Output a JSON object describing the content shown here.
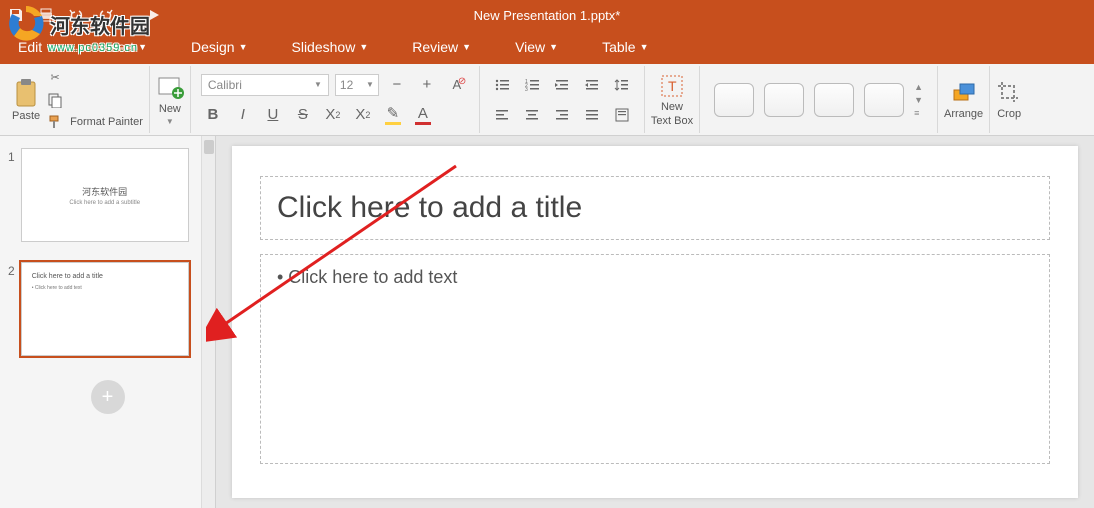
{
  "watermark": {
    "brand": "河东软件园",
    "url": "www.pc0359.cn"
  },
  "titlebar": {
    "doc_title": "New Presentation 1.pptx*"
  },
  "menus": {
    "edit": "Edit",
    "insert": "Insert",
    "design": "Design",
    "slideshow": "Slideshow",
    "review": "Review",
    "view": "View",
    "table": "Table"
  },
  "ribbon": {
    "paste": "Paste",
    "format_painter": "Format Painter",
    "new_slide": "New",
    "font_name": "Calibri",
    "font_size": "12",
    "new_text_box": "New",
    "new_text_box2": "Text Box",
    "arrange": "Arrange",
    "crop": "Crop"
  },
  "slides": {
    "s1": {
      "num": "1",
      "title": "河东软件园",
      "sub": "Click here to add a subtitle"
    },
    "s2": {
      "num": "2",
      "title": "Click here to add a title",
      "text": "• Click here to add text"
    }
  },
  "canvas": {
    "title_placeholder": "Click here to add a title",
    "content_placeholder": "• Click here to add text"
  }
}
